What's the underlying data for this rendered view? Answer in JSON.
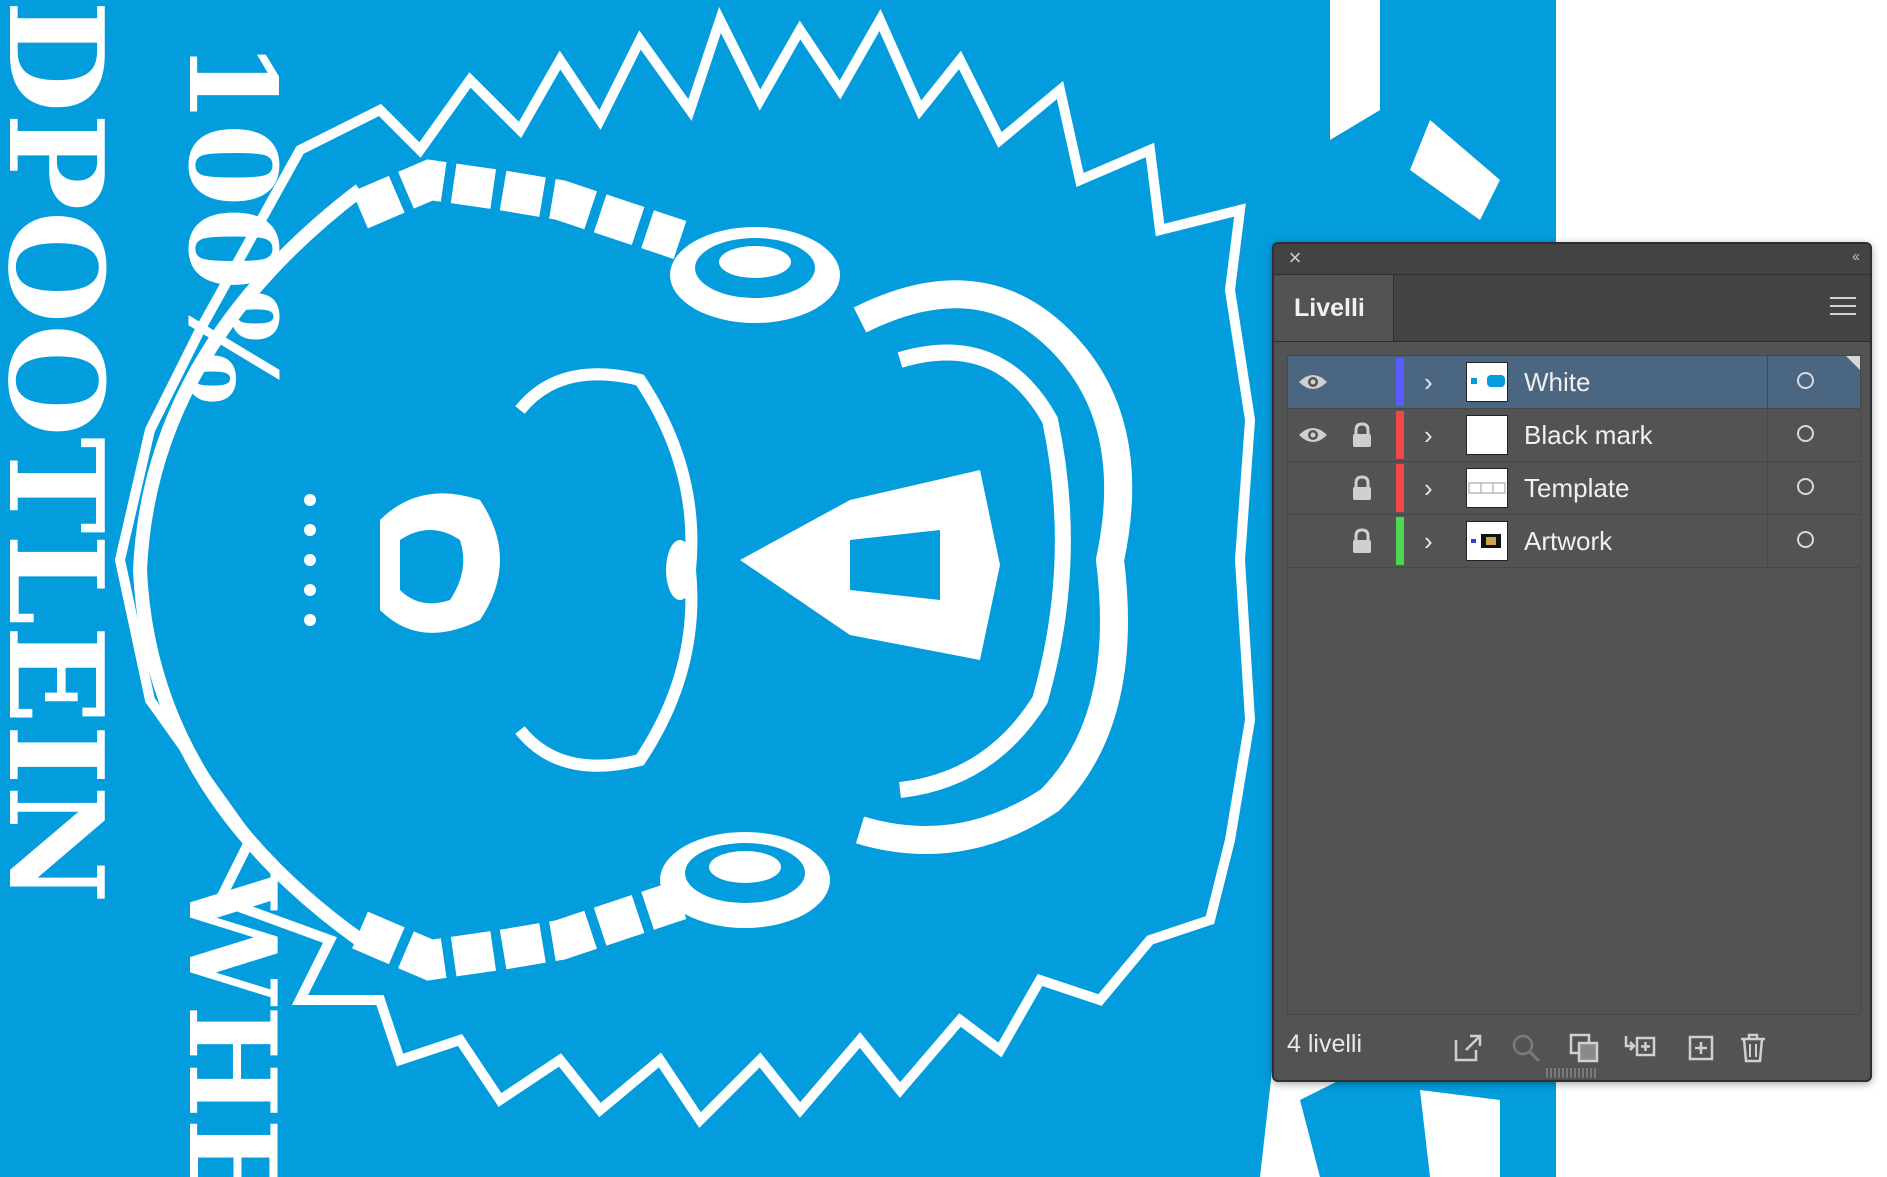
{
  "canvas": {
    "background_color": "#039ddd",
    "art_color": "#ffffff",
    "left_text": "100%",
    "bottom_text": "WHE",
    "edge_text": "DPOOTLEIN"
  },
  "panel": {
    "tab_label": "Livelli",
    "close_icon": "close-icon",
    "collapse_icon": "double-chevron-left-icon",
    "menu_icon": "hamburger-menu-icon",
    "layers": [
      {
        "name": "White",
        "visible": true,
        "locked": false,
        "color": "#5b5bff",
        "selected": true
      },
      {
        "name": "Black mark",
        "visible": true,
        "locked": true,
        "color": "#f04848",
        "selected": false
      },
      {
        "name": "Template",
        "visible": false,
        "locked": true,
        "color": "#f04848",
        "selected": false
      },
      {
        "name": "Artwork",
        "visible": false,
        "locked": true,
        "color": "#4fd84f",
        "selected": false
      }
    ],
    "footer": {
      "count_label": "4 livelli",
      "buttons": [
        "export-icon",
        "search-icon",
        "clipping-mask-icon",
        "new-sublayer-icon",
        "new-layer-icon",
        "trash-icon"
      ]
    }
  }
}
